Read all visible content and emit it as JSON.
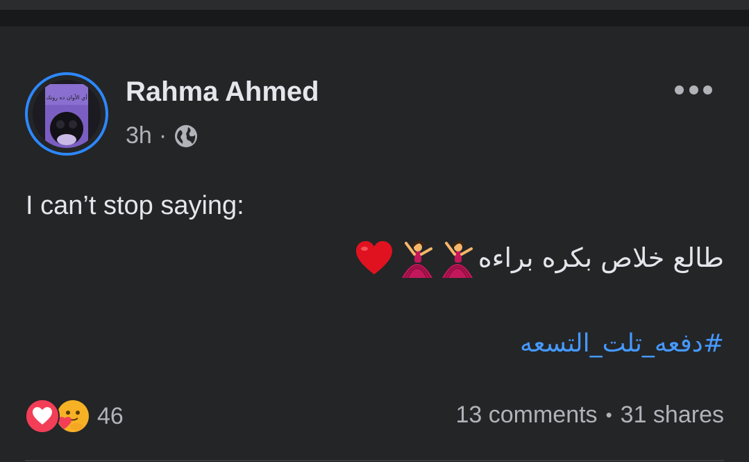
{
  "post": {
    "author": "Rahma Ahmed",
    "time": "3h",
    "separator": "·",
    "privacy_icon": "globe-icon",
    "more_icon": "more-options-icon",
    "avatar_caption": "أي الأوان ده رونك",
    "text_line1": "I can’t stop saying:",
    "text_line2": "طالع خلاص بكره براءه",
    "emojis": [
      "dancer-emoji",
      "dancer-emoji",
      "red-heart-emoji"
    ],
    "hashtag": "#دفعه_تلت_التسعه"
  },
  "footer": {
    "reaction_icons": [
      "love-reaction-icon",
      "care-reaction-icon"
    ],
    "reaction_count": "46",
    "comments": "13 comments",
    "dot": "•",
    "shares": "31 shares"
  },
  "colors": {
    "background": "#242527",
    "accent_blue": "#2d88ff",
    "hashtag_blue": "#4599ff",
    "text_primary": "#e4e6eb",
    "text_secondary": "#b0b3b8"
  }
}
